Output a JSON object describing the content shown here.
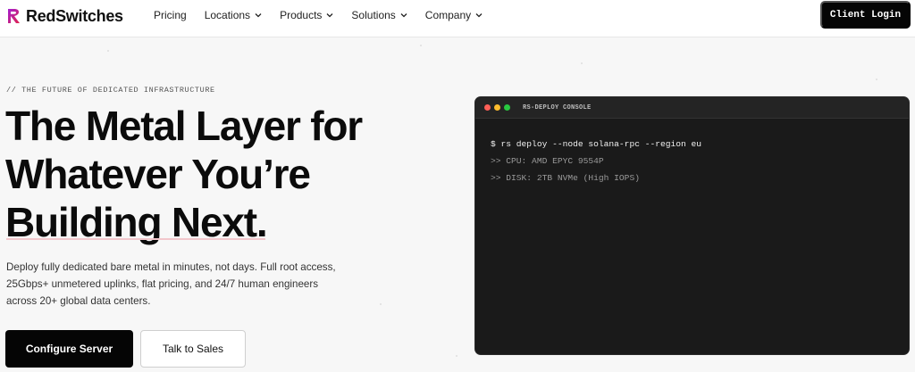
{
  "brand": {
    "name": "RedSwitches",
    "accent_color": "#e0244d",
    "accent_secondary": "#a31fd1",
    "logo_icon": "redswitches-logo-icon"
  },
  "nav": {
    "items": [
      {
        "label": "Pricing",
        "has_dropdown": false
      },
      {
        "label": "Locations",
        "has_dropdown": true
      },
      {
        "label": "Products",
        "has_dropdown": true
      },
      {
        "label": "Solutions",
        "has_dropdown": true
      },
      {
        "label": "Company",
        "has_dropdown": true
      }
    ],
    "client_login_label": "Client Login"
  },
  "hero": {
    "tagline": "// THE FUTURE OF DEDICATED INFRASTRUCTURE",
    "headline_lines": [
      "The Metal Layer for",
      "Whatever You’re",
      "Building Next."
    ],
    "description": "Deploy fully dedicated bare metal in minutes, not days. Full root access, 25Gbps+ unmetered uplinks, flat pricing, and 24/7 human engineers across 20+ global data centers.",
    "primary_cta": "Configure Server",
    "secondary_cta": "Talk to Sales"
  },
  "console": {
    "title": "RS-DEPLOY CONSOLE",
    "window_dots": [
      "#ff5f57",
      "#febc2e",
      "#28c840"
    ],
    "lines": [
      {
        "kind": "cmd",
        "text": "$ rs deploy --node solana-rpc --region eu"
      },
      {
        "kind": "out",
        "text": ">> CPU: AMD EPYC 9554P"
      },
      {
        "kind": "out",
        "text": ">> DISK: 2TB NVMe (High IOPS)"
      }
    ]
  }
}
